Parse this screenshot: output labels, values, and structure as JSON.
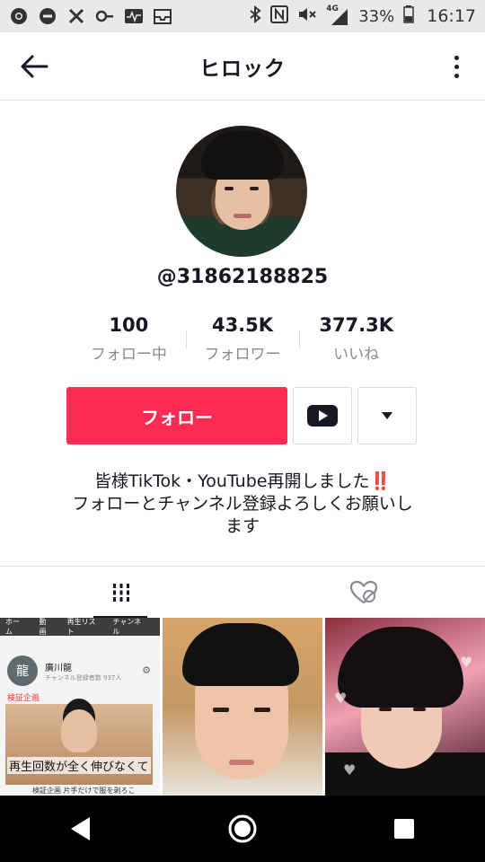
{
  "status_bar": {
    "battery": "33%",
    "time": "16:17",
    "network": "4G",
    "icons": [
      "chrome-icon",
      "dnd-icon",
      "tools-icon",
      "key-icon",
      "pulse-icon",
      "inbox-icon",
      "bluetooth-icon",
      "nfc-icon",
      "mute-icon",
      "signal-icon",
      "battery-icon"
    ]
  },
  "header": {
    "title": "ヒロック"
  },
  "profile": {
    "username": "@31862188825",
    "stats": [
      {
        "value": "100",
        "label": "フォロー中"
      },
      {
        "value": "43.5K",
        "label": "フォロワー"
      },
      {
        "value": "377.3K",
        "label": "いいね"
      }
    ],
    "follow_label": "フォロー",
    "bio_line1": "皆様TikTok・YouTube再開しました",
    "bio_emoji": "‼️",
    "bio_line2": "フォローとチャンネル登録よろしくお願いし",
    "bio_line3": "ます"
  },
  "grid": {
    "first": {
      "tabs": [
        "ホーム",
        "動画",
        "再生リスト",
        "チャンネル"
      ],
      "avatar_char": "龍",
      "channel_name": "廣川龍",
      "subscribers": "チャンネル登録者数 937人",
      "tag": "検証企画",
      "caption": "再生回数が全く伸びなくて",
      "footer": "検証企画 片手だけで服を剥ろこ"
    }
  },
  "colors": {
    "accent": "#fe2c55",
    "text": "#161823",
    "muted": "#8a8b91"
  }
}
